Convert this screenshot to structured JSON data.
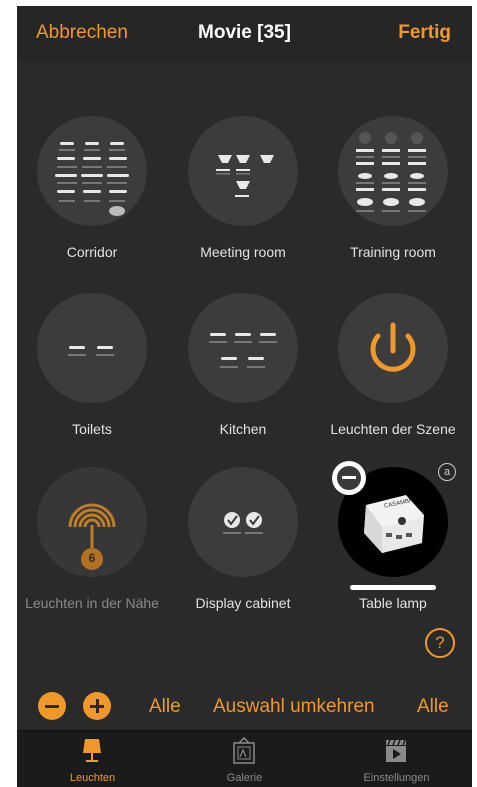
{
  "header": {
    "cancel_label": "Abbrechen",
    "title": "Movie [35]",
    "done_label": "Fertig"
  },
  "tiles": [
    {
      "label": "Corridor",
      "icon": "corridor-lights-icon"
    },
    {
      "label": "Meeting room",
      "icon": "meeting-room-lights-icon"
    },
    {
      "label": "Training room",
      "icon": "training-room-lights-icon"
    },
    {
      "label": "Toilets",
      "icon": "toilets-lights-icon"
    },
    {
      "label": "Kitchen",
      "icon": "kitchen-lights-icon"
    },
    {
      "label": "Leuchten der Szene",
      "icon": "power-icon"
    },
    {
      "label": "Leuchten in der Nähe",
      "icon": "nearby-signal-icon",
      "badge": "6"
    },
    {
      "label": "Display cabinet",
      "icon": "display-cabinet-icon"
    },
    {
      "label": "Table lamp",
      "icon": "table-lamp-device-icon",
      "badge_text": "a",
      "device_label": "CASAMBI",
      "selected": true
    }
  ],
  "help_label": "?",
  "bottom_bar": {
    "select_all_label": "Alle",
    "invert_label": "Auswahl umkehren",
    "select_all_label_2": "Alle"
  },
  "tabs": [
    {
      "label": "Leuchten",
      "active": true
    },
    {
      "label": "Galerie",
      "active": false
    },
    {
      "label": "Einstellungen",
      "active": false
    }
  ],
  "colors": {
    "accent": "#f0992a",
    "background": "#2a2a2a",
    "circle": "#3c3c3c",
    "tabbar": "#1b1b1b"
  }
}
